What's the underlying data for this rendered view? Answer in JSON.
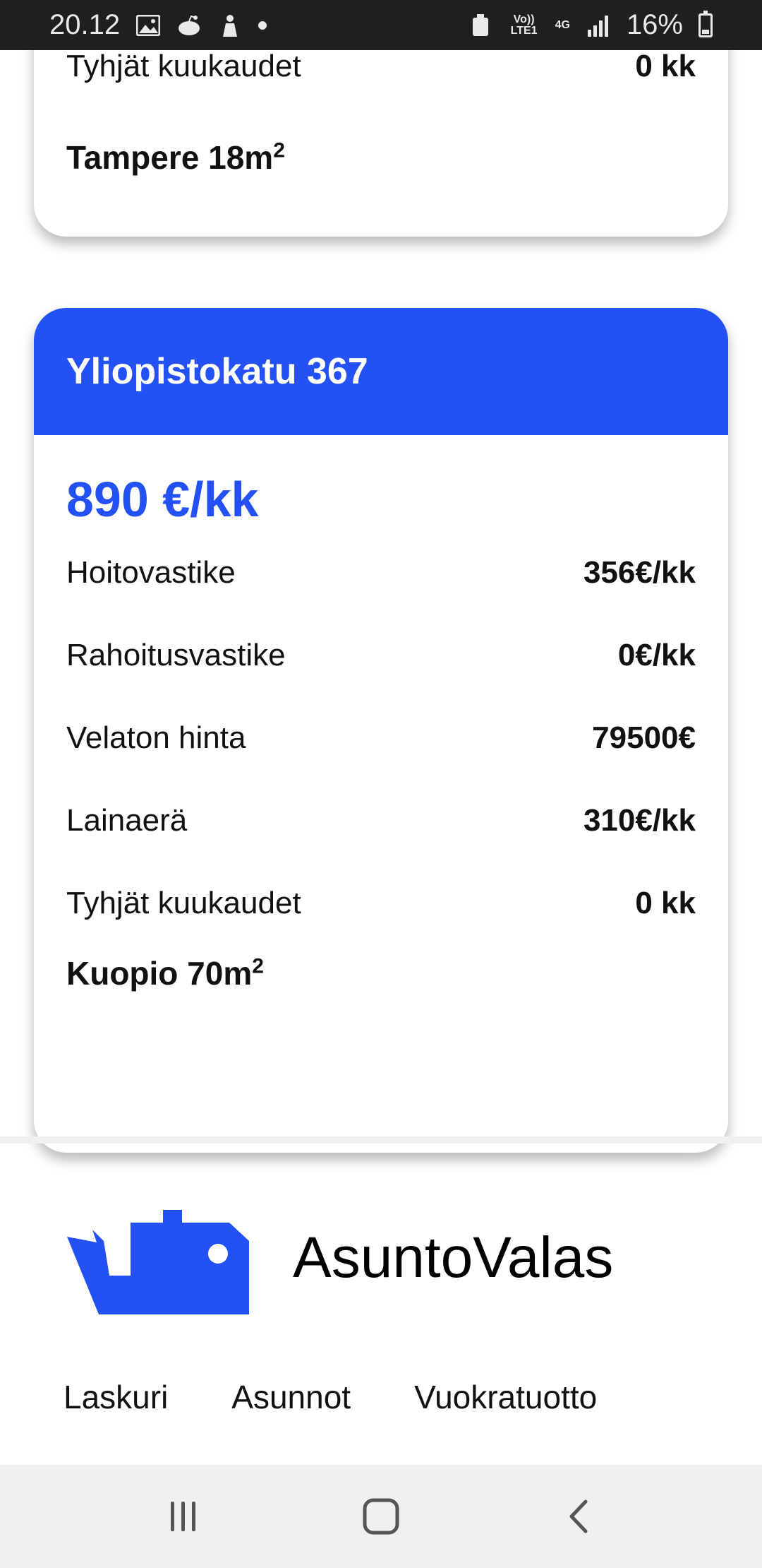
{
  "status_bar": {
    "time": "20.12",
    "battery": "16%",
    "network_volte": "Vo)) LTE1",
    "network_4g": "4G"
  },
  "previous_card": {
    "row_label": "Tyhjät kuukaudet",
    "row_value": "0 kk",
    "location": "Tampere 18m",
    "location_sup": "2"
  },
  "card": {
    "title": "Yliopistokatu 367",
    "price": "890 €/kk",
    "rows": [
      {
        "label": "Hoitovastike",
        "value": "356€/kk"
      },
      {
        "label": "Rahoitusvastike",
        "value": "0€/kk"
      },
      {
        "label": "Velaton hinta",
        "value": "79500€"
      },
      {
        "label": "Lainaerä",
        "value": "310€/kk"
      },
      {
        "label": "Tyhjät kuukaudet",
        "value": "0 kk"
      }
    ],
    "location": "Kuopio 70m",
    "location_sup": "2"
  },
  "brand": {
    "name": "AsuntoValas",
    "color": "#2351f5"
  },
  "footer_nav": [
    "Laskuri",
    "Asunnot",
    "Vuokratuotto"
  ],
  "nav_icons": [
    "recent-apps-icon",
    "home-icon",
    "back-icon"
  ]
}
